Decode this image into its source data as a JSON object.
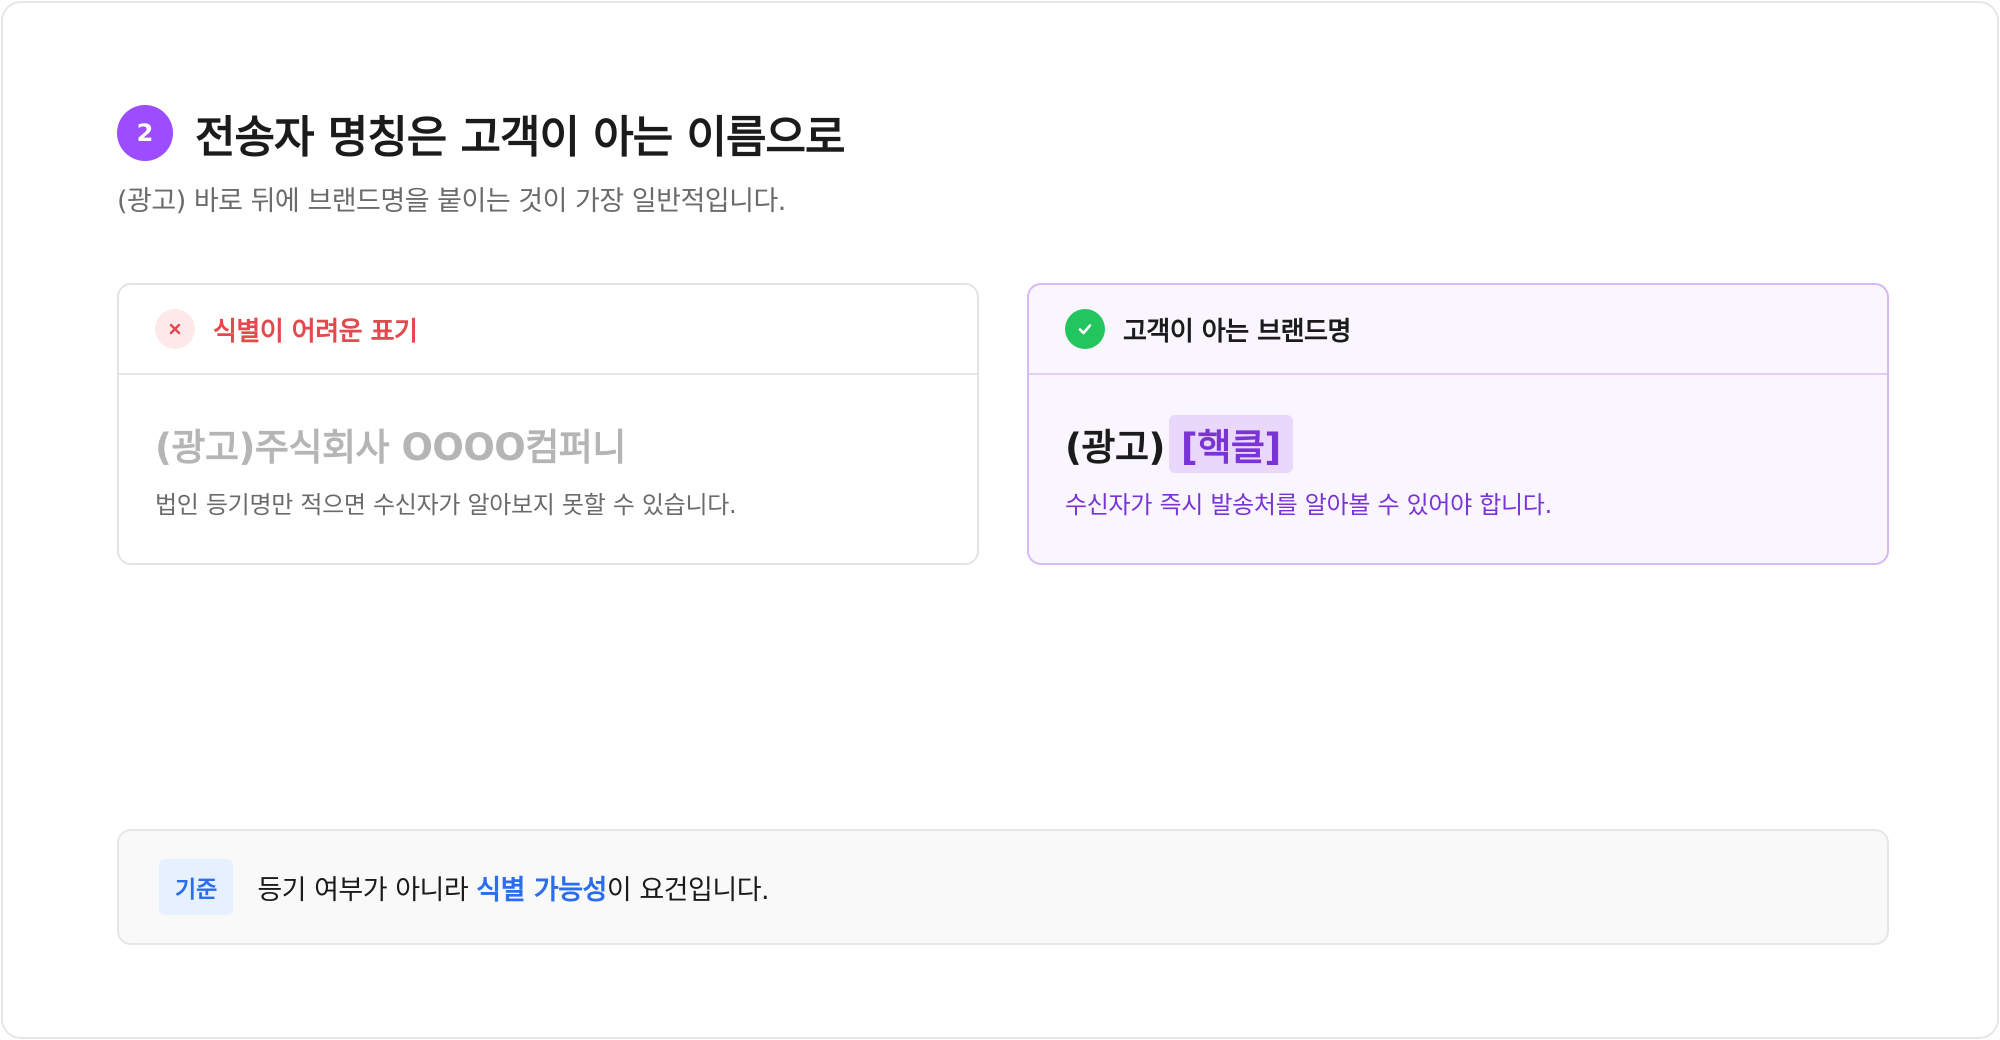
{
  "header": {
    "step_number": "2",
    "title": "전송자 명칭은 고객이 아는 이름으로",
    "subtitle": "(광고) 바로 뒤에 브랜드명을 붙이는 것이 가장 일반적입니다."
  },
  "bad_example": {
    "label": "식별이 어려운 표기",
    "example_text": "(광고)주식회사 OOOO컴퍼니",
    "description": "법인 등기명만 적으면 수신자가 알아보지 못할 수 있습니다.",
    "icon": "close-icon"
  },
  "good_example": {
    "label": "고객이 아는 브랜드명",
    "example_prefix": "(광고)",
    "example_brand": "[핵클]",
    "description": "수신자가 즉시 발송처를 알아볼 수 있어야 합니다.",
    "icon": "check-icon"
  },
  "criteria": {
    "tag": "기준",
    "text_before": "등기 여부가 아니라 ",
    "text_emphasis": "식별 가능성",
    "text_after": "이 요건입니다."
  },
  "colors": {
    "accent_purple": "#9b4dff",
    "error_red": "#e5484d",
    "success_green": "#22c55e",
    "highlight_purple": "#7a34d6",
    "info_blue": "#2b6cf0"
  }
}
